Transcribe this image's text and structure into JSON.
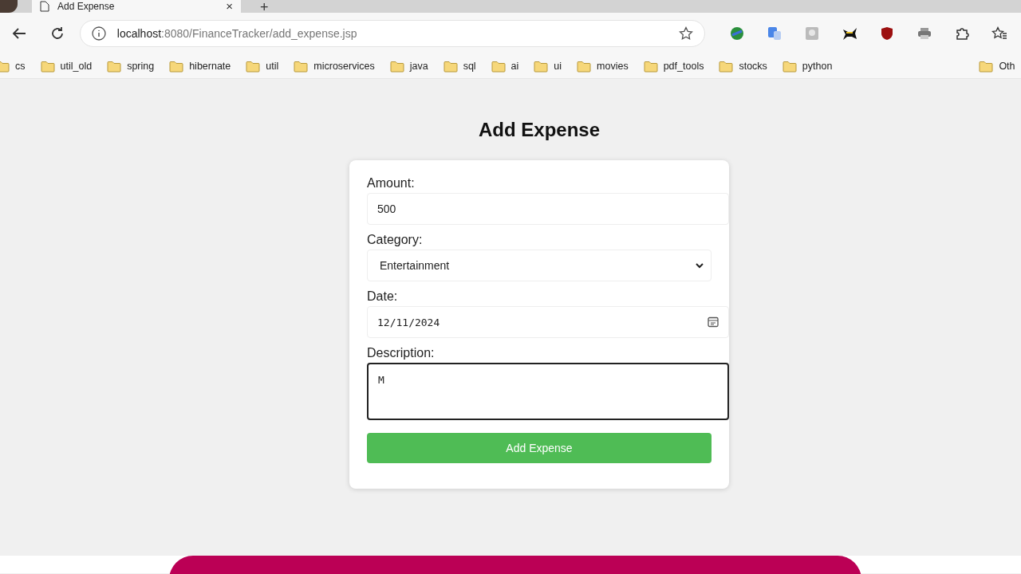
{
  "browser": {
    "tab": {
      "title": "Add Expense",
      "close": "×"
    },
    "new_tab": "+",
    "address": {
      "host": "localhost",
      "path": ":8080/FinanceTracker/add_expense.jsp"
    },
    "bookmarks": [
      "cs",
      "util_old",
      "spring",
      "hibernate",
      "util",
      "microservices",
      "java",
      "sql",
      "ai",
      "ui",
      "movies",
      "pdf_tools",
      "stocks",
      "python"
    ],
    "other_bookmarks": "Oth"
  },
  "page": {
    "heading": "Add Expense",
    "fields": [
      {
        "kind": "text",
        "label": "Amount:",
        "value": "500",
        "focused": false
      },
      {
        "kind": "select",
        "label": "Category:",
        "value": "Entertainment",
        "focused": false
      },
      {
        "kind": "date",
        "label": "Date:",
        "value": "12/11/2024",
        "focused": false
      },
      {
        "kind": "textarea",
        "label": "Description:",
        "value": "M",
        "focused": true
      }
    ],
    "submit": "Add Expense"
  }
}
